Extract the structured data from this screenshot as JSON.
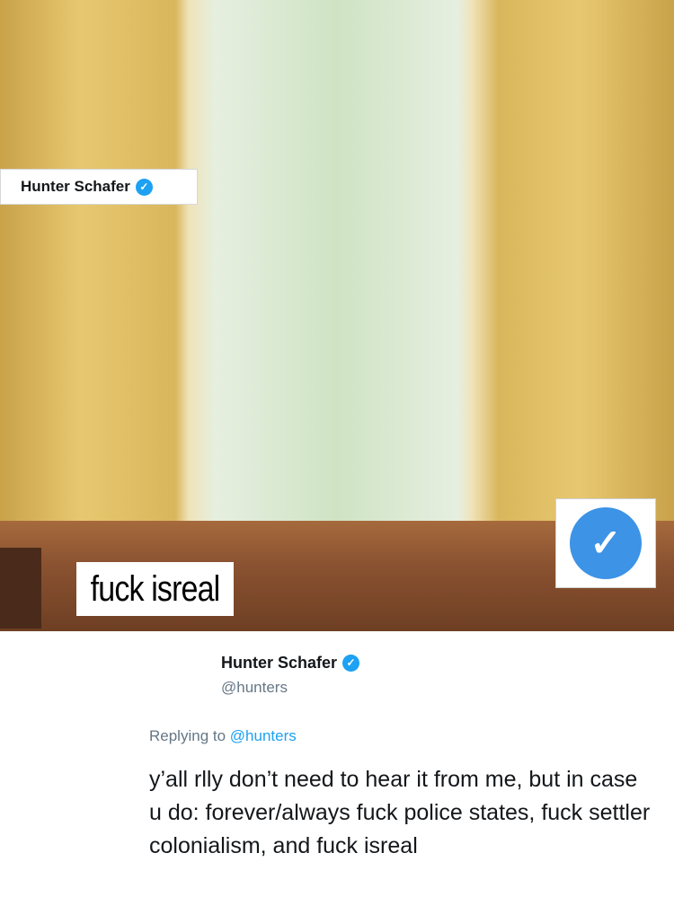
{
  "photo": {
    "overlay_name": "Hunter Schafer",
    "overlay_caption": "fuck isreal"
  },
  "tweet": {
    "display_name": "Hunter Schafer",
    "handle": "@hunters",
    "replying_prefix": "Replying to",
    "replying_to": "@hunters",
    "text": "y’all rlly don’t need to hear it from me, but in case u do: forever/always fuck police states, fuck settler colonialism, and fuck isreal"
  },
  "colors": {
    "verified_blue": "#1da1f2",
    "muted_text": "#657786",
    "body_text": "#14171a"
  }
}
